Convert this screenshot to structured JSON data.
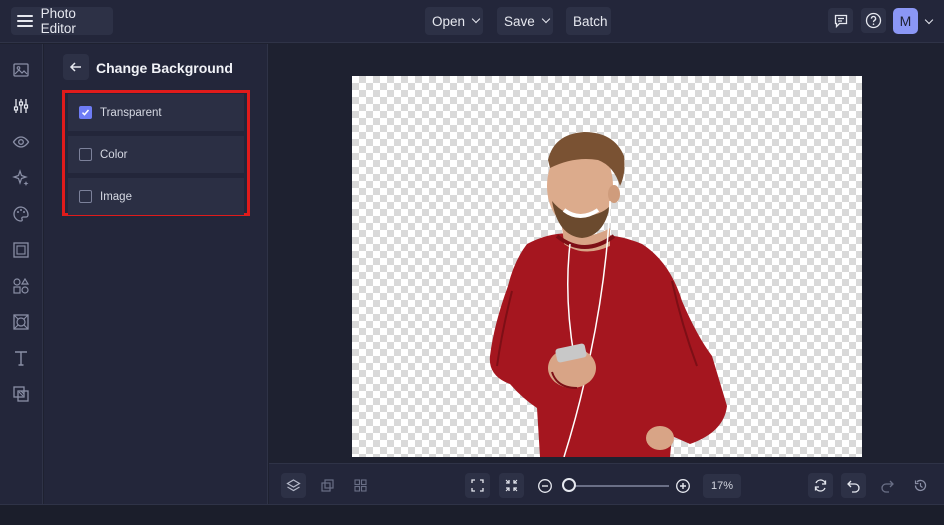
{
  "app": {
    "title": "Photo Editor",
    "avatar_initial": "M"
  },
  "menu": {
    "open_label": "Open",
    "save_label": "Save",
    "batch_label": "Batch"
  },
  "panel": {
    "title": "Change Background",
    "options": [
      {
        "label": "Transparent",
        "checked": true
      },
      {
        "label": "Color",
        "checked": false
      },
      {
        "label": "Image",
        "checked": false
      }
    ]
  },
  "zoom": {
    "value": "17%",
    "level": 0.17
  },
  "rail_icons": [
    "image-icon",
    "adjustments-icon",
    "eye-icon",
    "sparkle-icon",
    "palette-icon",
    "frame-icon",
    "shapes-icon",
    "texture-icon",
    "text-icon",
    "overlay-icon"
  ],
  "colors": {
    "accent": "#6e7cf5",
    "highlight": "#e01b1b",
    "shirt": "#a5161f"
  }
}
